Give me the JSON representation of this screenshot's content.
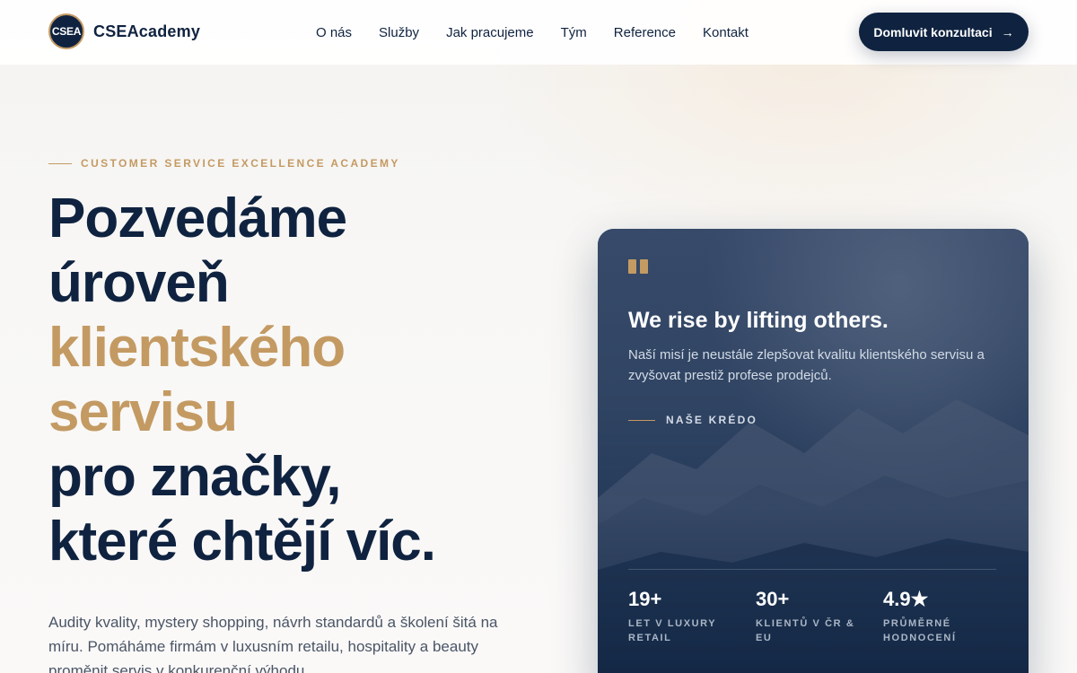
{
  "header": {
    "logo_badge": "CSEA",
    "logo_text": "CSEAcademy",
    "nav": [
      "O nás",
      "Služby",
      "Jak pracujeme",
      "Tým",
      "Reference",
      "Kontakt"
    ],
    "cta_label": "Domluvit konzultaci",
    "cta_icon": "arrow-right-icon"
  },
  "hero": {
    "eyebrow": "CUSTOMER SERVICE EXCELLENCE ACADEMY",
    "headline": {
      "line1": "Pozvedáme",
      "line2": "úroveň",
      "line3": "klientského",
      "line4": "servisu",
      "line5": "pro značky,",
      "line6": "které chtějí víc."
    },
    "lead": "Audity kvality, mystery shopping, návrh standardů a školení šitá na míru. Pomáháme firmám v luxusním retailu, hospitality a beauty proměnit servis v konkurenční výhodu."
  },
  "card": {
    "title": "We rise by lifting others.",
    "text": "Naší misí je neustále zlepšovat kvalitu klientského servisu a zvyšovat prestiž profese prodejců.",
    "credo": "NAŠE KRÉDO",
    "stats": [
      {
        "value": "19+",
        "label_line1": "LET V LUXURY",
        "label_line2": "RETAIL"
      },
      {
        "value": "30+",
        "label_line1": "KLIENTŮ V ČR & EU",
        "label_line2": ""
      },
      {
        "value": "4.9★",
        "label_line1": "PRŮMĚRNÉ",
        "label_line2": "HODNOCENÍ"
      }
    ]
  },
  "colors": {
    "navy": "#0f2340",
    "gold": "#c49a63",
    "background": "#f7f5f2"
  }
}
